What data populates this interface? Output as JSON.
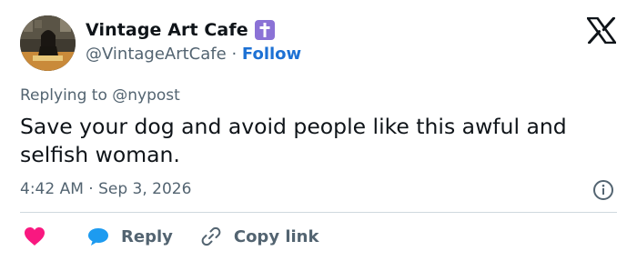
{
  "author": {
    "display_name": "Vintage Art Cafe",
    "handle": "@VintageArtCafe",
    "separator": "·",
    "follow_label": "Follow",
    "badge_icon": "cross-icon",
    "badge_color": "#8b72d6"
  },
  "reply_context": {
    "prefix": "Replying to",
    "handle": "@nypost"
  },
  "tweet": {
    "text": "Save your dog and avoid people like this awful and selfish woman.",
    "time": "4:42 AM",
    "separator": "·",
    "date": "Sep 3, 2026"
  },
  "actions": {
    "like_icon": "heart-icon",
    "reply_label": "Reply",
    "copy_link_label": "Copy link"
  },
  "colors": {
    "text": "#0f1419",
    "secondary": "#536471",
    "link": "#1d71d4",
    "heart": "#f91880",
    "reply_bubble": "#1d9bf0"
  }
}
